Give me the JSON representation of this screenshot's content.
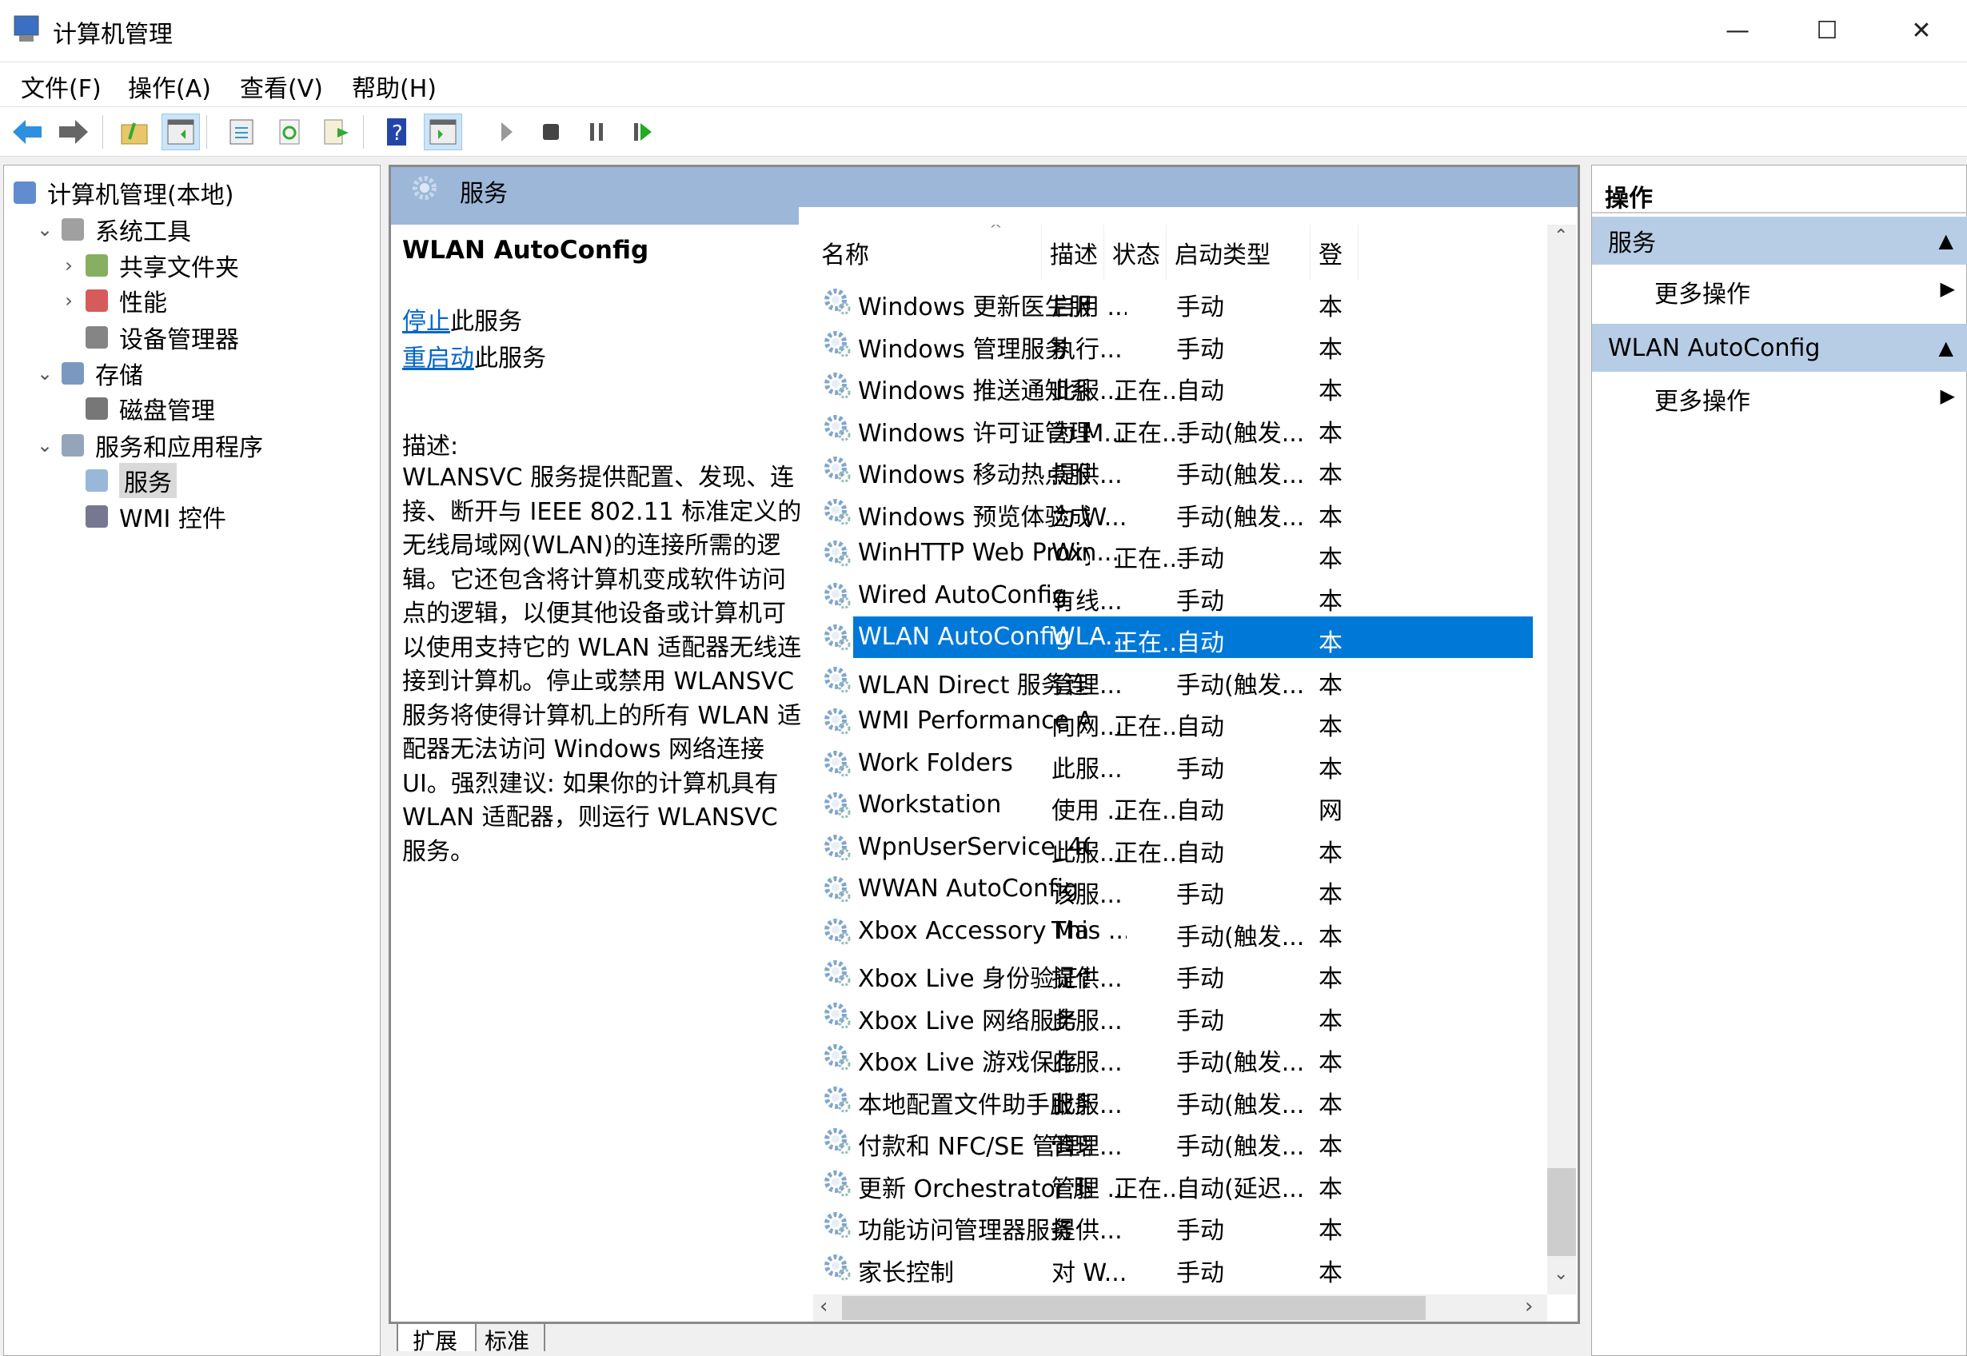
{
  "window": {
    "title": "计算机管理",
    "minimize": "—",
    "maximize": "☐",
    "close": "✕"
  },
  "menu": [
    "文件(F)",
    "操作(A)",
    "查看(V)",
    "帮助(H)"
  ],
  "toolbar": [
    "back-icon",
    "forward-icon",
    "up-folder-icon",
    "show-hide-tree-icon",
    "properties-icon",
    "refresh-icon",
    "export-list-icon",
    "help-icon",
    "show-hide-action-pane-icon",
    "start-service-icon",
    "stop-service-icon",
    "pause-service-icon",
    "resume-service-icon"
  ],
  "tree": [
    {
      "label": "计算机管理(本地)",
      "level": 0,
      "chev": ""
    },
    {
      "label": "系统工具",
      "level": 1,
      "chev": "⌄"
    },
    {
      "label": "共享文件夹",
      "level": 2,
      "chev": "›"
    },
    {
      "label": "性能",
      "level": 2,
      "chev": "›"
    },
    {
      "label": "设备管理器",
      "level": 2,
      "chev": ""
    },
    {
      "label": "存储",
      "level": 1,
      "chev": "⌄"
    },
    {
      "label": "磁盘管理",
      "level": 2,
      "chev": ""
    },
    {
      "label": "服务和应用程序",
      "level": 1,
      "chev": "⌄"
    },
    {
      "label": "服务",
      "level": 2,
      "chev": "",
      "selected": true
    },
    {
      "label": "WMI 控件",
      "level": 2,
      "chev": ""
    }
  ],
  "middle": {
    "header": "服务",
    "selected_name": "WLAN AutoConfig",
    "stop_link": "停止",
    "stop_suffix": "此服务",
    "restart_link": "重启动",
    "restart_suffix": "此服务",
    "desc_label": "描述:",
    "desc_lines": [
      "WLANSVC 服务提供配置、发现、连",
      "接、断开与 IEEE 802.11 标准定义的",
      "无线局域网(WLAN)的连接所需的逻",
      "辑。它还包含将计算机变成软件访问",
      "点的逻辑，以便其他设备或计算机可",
      "以使用支持它的 WLAN 适配器无线连",
      "接到计算机。停止或禁用 WLANSVC",
      "服务将使得计算机上的所有 WLAN 适",
      "配器无法访问 Windows 网络连接",
      "UI。强烈建议: 如果你的计算机具有",
      "WLAN 适配器，则运行 WLANSVC",
      "服务。"
    ],
    "columns": [
      "名称",
      "描述",
      "状态",
      "启动类型",
      "登"
    ],
    "sort_indicator": "^",
    "rows": [
      [
        "Windows 更新医生服务",
        "启用 ...",
        "",
        "手动",
        "本"
      ],
      [
        "Windows 管理服务",
        "执行...",
        "",
        "手动",
        "本"
      ],
      [
        "Windows 推送通知系统服务",
        "此服...",
        "正在...",
        "自动",
        "本"
      ],
      [
        "Windows 许可证管理器服务",
        "为 M...",
        "正在...",
        "手动(触发...",
        "本"
      ],
      [
        "Windows 移动热点服务",
        "提供...",
        "",
        "手动(触发...",
        "本"
      ],
      [
        "Windows 预览体验成员服务",
        "为 W...",
        "",
        "手动(触发...",
        "本"
      ],
      [
        "WinHTTP Web Proxy Auto-...",
        "Win...",
        "正在...",
        "手动",
        "本"
      ],
      [
        "Wired AutoConfig",
        "有线...",
        "",
        "手动",
        "本"
      ],
      [
        "WLAN AutoConfig",
        "WLA...",
        "正在...",
        "自动",
        "本"
      ],
      [
        "WLAN Direct 服务连接管理...",
        "管理...",
        "",
        "手动(触发...",
        "本"
      ],
      [
        "WMI Performance Adapter",
        "向网...",
        "正在...",
        "自动",
        "本"
      ],
      [
        "Work Folders",
        "此服...",
        "",
        "手动",
        "本"
      ],
      [
        "Workstation",
        "使用 ...",
        "正在...",
        "自动",
        "网"
      ],
      [
        "WpnUserService_40037",
        "此服...",
        "正在...",
        "自动",
        "本"
      ],
      [
        "WWAN AutoConfig",
        "该服...",
        "",
        "手动",
        "本"
      ],
      [
        "Xbox Accessory Manageme...",
        "This ...",
        "",
        "手动(触发...",
        "本"
      ],
      [
        "Xbox Live 身份验证管理器",
        "提供...",
        "",
        "手动",
        "本"
      ],
      [
        "Xbox Live 网络服务",
        "此服...",
        "",
        "手动",
        "本"
      ],
      [
        "Xbox Live 游戏保存",
        "此服...",
        "",
        "手动(触发...",
        "本"
      ],
      [
        "本地配置文件助手服务",
        "此服...",
        "",
        "手动(触发...",
        "本"
      ],
      [
        "付款和 NFC/SE 管理器",
        "管理...",
        "",
        "手动(触发...",
        "本"
      ],
      [
        "更新 Orchestrator 服务",
        "管理 ...",
        "正在...",
        "自动(延迟...",
        "本"
      ],
      [
        "功能访问管理器服务",
        "提供...",
        "",
        "手动",
        "本"
      ],
      [
        "家长控制",
        "对 W...",
        "",
        "手动",
        "本"
      ]
    ],
    "selected_row": 8,
    "tabs": [
      "扩展",
      "标准"
    ]
  },
  "actions": {
    "title": "操作",
    "sections": [
      {
        "header": "服务",
        "item": "更多操作"
      },
      {
        "header": "WLAN AutoConfig",
        "item": "更多操作"
      }
    ]
  },
  "colors": {
    "selection": "#0078d7",
    "pane_header": "#9cb7d8",
    "action_header": "#b7cde6",
    "link": "#0066cc"
  }
}
